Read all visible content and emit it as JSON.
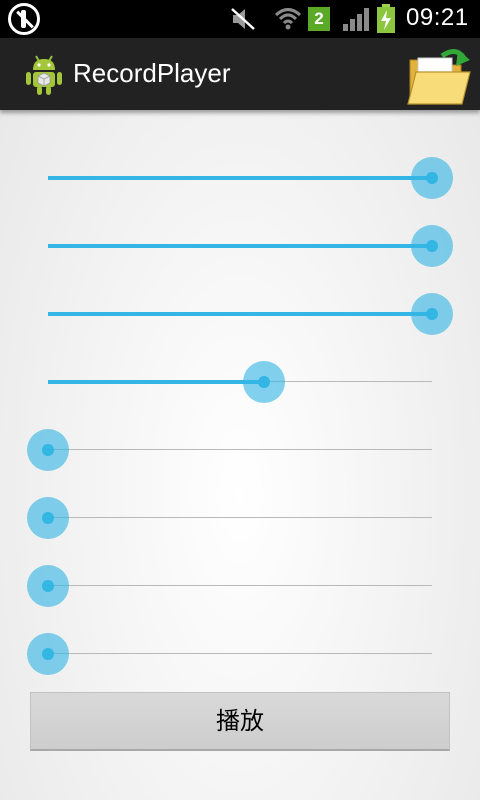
{
  "status_bar": {
    "time": "09:21",
    "sim_label": "2",
    "icons": [
      "usb-debug-icon",
      "mute-icon",
      "wifi-icon",
      "sim-icon",
      "signal-icon",
      "battery-charging-icon"
    ]
  },
  "action_bar": {
    "title": "RecordPlayer",
    "app_icon": "android-robot-icon",
    "folder_icon": "open-folder-icon"
  },
  "sliders": [
    {
      "name": "seekbar-1",
      "value": 1.0
    },
    {
      "name": "seekbar-2",
      "value": 1.0
    },
    {
      "name": "seekbar-3",
      "value": 1.0
    },
    {
      "name": "seekbar-4",
      "value": 0.5625
    },
    {
      "name": "seekbar-5",
      "value": 0.0
    },
    {
      "name": "seekbar-6",
      "value": 0.0
    },
    {
      "name": "seekbar-7",
      "value": 0.0
    },
    {
      "name": "seekbar-8",
      "value": 0.0
    }
  ],
  "play_button": {
    "label": "播放"
  },
  "colors": {
    "accent": "#33b5e5",
    "action_bar": "#222222",
    "status_bar": "#000000"
  }
}
